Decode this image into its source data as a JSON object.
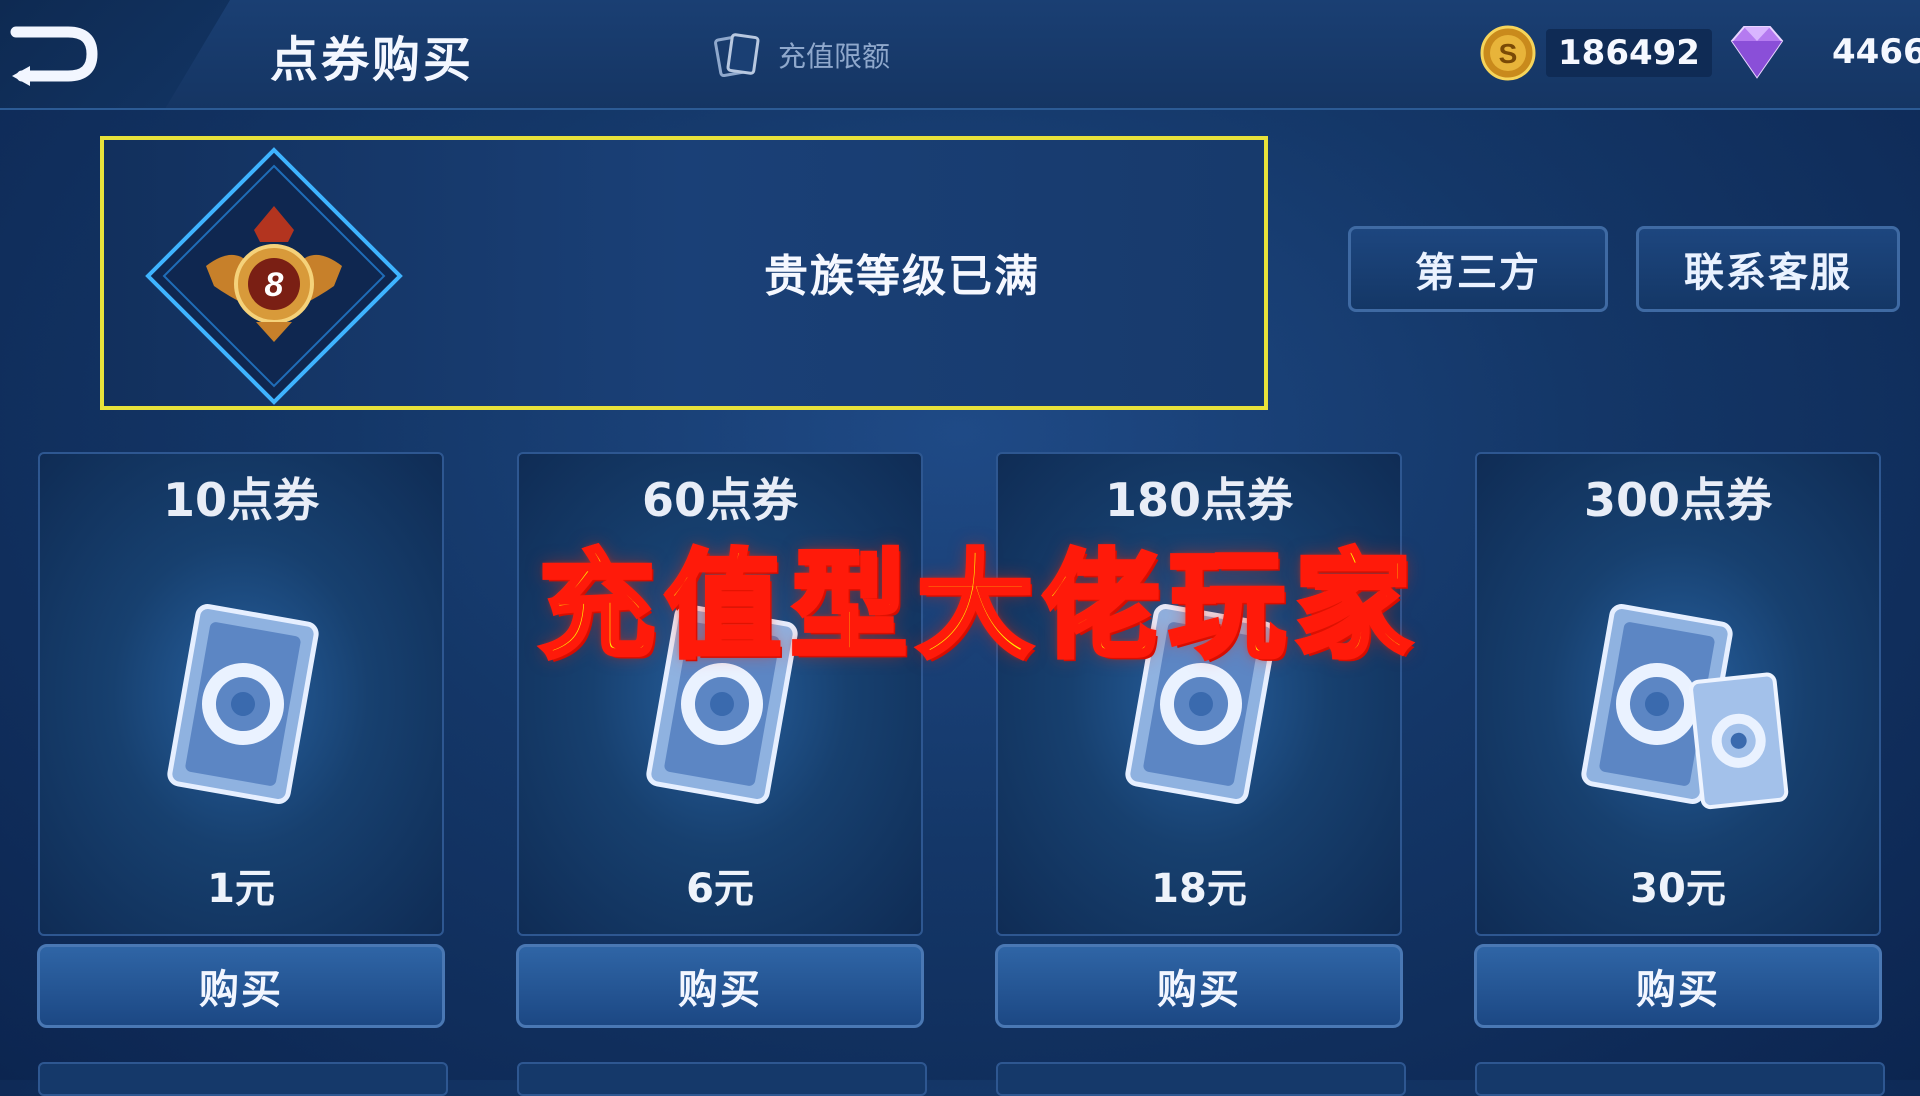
{
  "header": {
    "title": "点券购买",
    "recharge_limit_label": "充值限额",
    "coins": "186492",
    "diamonds": "4466"
  },
  "noble": {
    "level": "8",
    "status": "贵族等级已满"
  },
  "side_buttons": {
    "third_party": "第三方",
    "customer_service": "联系客服"
  },
  "cards": [
    {
      "title": "10点券",
      "price": "1元",
      "buy_label": "购买"
    },
    {
      "title": "60点券",
      "price": "6元",
      "buy_label": "购买"
    },
    {
      "title": "180点券",
      "price": "18元",
      "buy_label": "购买"
    },
    {
      "title": "300点券",
      "price": "30元",
      "buy_label": "购买"
    }
  ],
  "overlay": {
    "caption": "充值型大佬玩家"
  },
  "icons": {
    "back": "back-arrow-icon",
    "limit": "card-icon",
    "coin": "gold-coin-icon",
    "diamond": "diamond-icon",
    "noble": "noble-badge-icon",
    "ticket": "voucher-ticket-icon"
  },
  "colors": {
    "highlight_border": "#e8e23a",
    "caption_fill": "#fff200",
    "caption_stroke": "#ff1a0a"
  }
}
